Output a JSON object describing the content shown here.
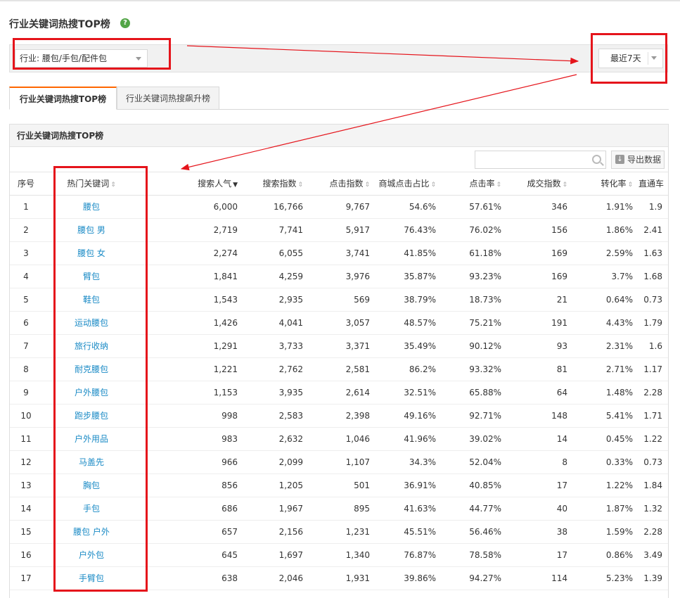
{
  "page_title": "行业关键词热搜TOP榜",
  "help_icon_glyph": "?",
  "filters": {
    "industry": "行业: 腰包/手包/配件包",
    "period": "最近7天"
  },
  "tabs": [
    {
      "label": "行业关键词热搜TOP榜",
      "active": true
    },
    {
      "label": "行业关键词热搜飙升榜",
      "active": false
    }
  ],
  "panel": {
    "title": "行业关键词热搜TOP榜",
    "search_placeholder": "",
    "export_label": "导出数据"
  },
  "table": {
    "headers": [
      "序号",
      "热门关键词",
      "搜索人气",
      "搜索指数",
      "点击指数",
      "商城点击占比",
      "点击率",
      "成交指数",
      "转化率",
      "直通车"
    ],
    "sorted_column": "搜索人气",
    "rows": [
      [
        "1",
        "腰包",
        "6,000",
        "16,766",
        "9,767",
        "54.6%",
        "57.61%",
        "346",
        "1.91%",
        "1.9"
      ],
      [
        "2",
        "腰包 男",
        "2,719",
        "7,741",
        "5,917",
        "76.43%",
        "76.02%",
        "156",
        "1.86%",
        "2.41"
      ],
      [
        "3",
        "腰包 女",
        "2,274",
        "6,055",
        "3,741",
        "41.85%",
        "61.18%",
        "169",
        "2.59%",
        "1.63"
      ],
      [
        "4",
        "臂包",
        "1,841",
        "4,259",
        "3,976",
        "35.87%",
        "93.23%",
        "169",
        "3.7%",
        "1.68"
      ],
      [
        "5",
        "鞋包",
        "1,543",
        "2,935",
        "569",
        "38.79%",
        "18.73%",
        "21",
        "0.64%",
        "0.73"
      ],
      [
        "6",
        "运动腰包",
        "1,426",
        "4,041",
        "3,057",
        "48.57%",
        "75.21%",
        "191",
        "4.43%",
        "1.79"
      ],
      [
        "7",
        "旅行收纳",
        "1,291",
        "3,733",
        "3,371",
        "35.49%",
        "90.12%",
        "93",
        "2.31%",
        "1.6"
      ],
      [
        "8",
        "耐克腰包",
        "1,221",
        "2,762",
        "2,581",
        "86.2%",
        "93.32%",
        "81",
        "2.71%",
        "1.17"
      ],
      [
        "9",
        "户外腰包",
        "1,153",
        "3,935",
        "2,614",
        "32.51%",
        "65.88%",
        "64",
        "1.48%",
        "2.28"
      ],
      [
        "10",
        "跑步腰包",
        "998",
        "2,583",
        "2,398",
        "49.16%",
        "92.71%",
        "148",
        "5.41%",
        "1.71"
      ],
      [
        "11",
        "户外用品",
        "983",
        "2,632",
        "1,046",
        "41.96%",
        "39.02%",
        "14",
        "0.45%",
        "1.22"
      ],
      [
        "12",
        "马盖先",
        "966",
        "2,099",
        "1,107",
        "34.3%",
        "52.04%",
        "8",
        "0.33%",
        "0.73"
      ],
      [
        "13",
        "胸包",
        "856",
        "1,205",
        "501",
        "36.91%",
        "40.85%",
        "17",
        "1.22%",
        "1.84"
      ],
      [
        "14",
        "手包",
        "686",
        "1,967",
        "895",
        "41.63%",
        "44.77%",
        "40",
        "1.87%",
        "1.32"
      ],
      [
        "15",
        "腰包 户外",
        "657",
        "2,156",
        "1,231",
        "45.51%",
        "56.46%",
        "38",
        "1.59%",
        "2.28"
      ],
      [
        "16",
        "户外包",
        "645",
        "1,697",
        "1,340",
        "76.87%",
        "78.58%",
        "17",
        "0.86%",
        "3.49"
      ],
      [
        "17",
        "手臂包",
        "638",
        "2,046",
        "1,931",
        "39.86%",
        "94.27%",
        "114",
        "5.23%",
        "1.39"
      ]
    ]
  },
  "colors": {
    "annotation_red": "#e5141b",
    "link_blue": "#1b8bc6",
    "help_green": "#52a546",
    "tab_accent": "#ff6600"
  }
}
